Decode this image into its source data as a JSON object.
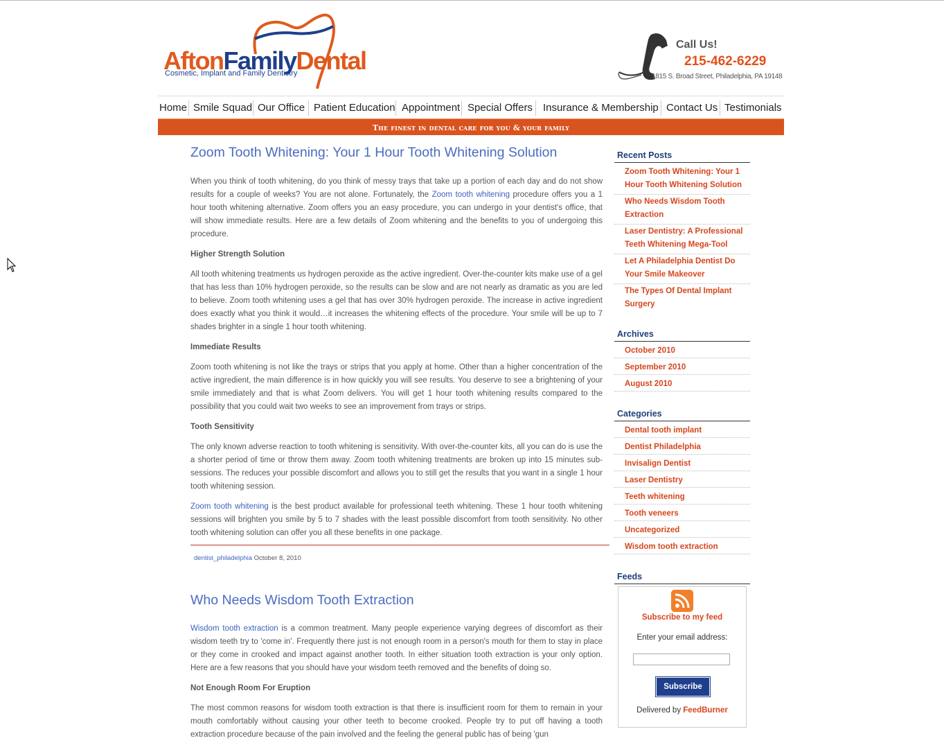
{
  "header": {
    "logo": {
      "word1": "Afton",
      "word2": "Family",
      "word3": "Dental",
      "tagline": "Cosmetic, Implant and Family Dentistry"
    },
    "call_label": "Call Us!",
    "phone": "215-462-6229",
    "address": "1815 S. Broad Street, Philadelphia, PA 19148"
  },
  "nav": {
    "items": [
      "Home",
      "Smile Squad",
      "Our Office",
      "Patient Education",
      "Appointment",
      "Special Offers",
      "Insurance & Membership",
      "Contact Us",
      "Testimonials"
    ]
  },
  "banner": "The finest in dental care for you & your family",
  "posts": [
    {
      "title": "Zoom Tooth Whitening: Your 1 Hour Tooth Whitening Solution",
      "intro_a": "When you think of tooth whitening, do you think of messy trays that take up a portion of each day and do not show results for a couple of weeks? You are not alone. Fortunately, the ",
      "intro_link": "Zoom tooth whitening",
      "intro_b": " procedure offers you a 1 hour tooth whitening alternative. Zoom offers you an easy procedure, you can undergo in your dentist's office, that will show immediate results. Here are a few details of Zoom whitening and the benefits to you of undergoing this procedure.",
      "h1": "Higher Strength Solution",
      "p1": "All tooth whitening treatments us hydrogen peroxide as the active ingredient. Over-the-counter kits make use of a gel that has less than 10% hydrogen peroxide, so the results can be slow and are not nearly as dramatic as you are led to believe. Zoom tooth whitening uses a gel that has over 30% hydrogen peroxide. The increase in active ingredient does exactly what you think it would…it increases the whitening effects of the procedure. Your smile will be up to 7 shades brighter in a single 1 hour tooth whitening.",
      "h2": "Immediate Results",
      "p2": "Zoom tooth whitening is not like the trays or strips that you apply at home. Other than a higher concentration of the active ingredient, the main difference is in how quickly you will see results. You deserve to see a brightening of your smile immediately and that is what Zoom delivers. You will get 1 hour tooth whitening results compared to the possibility that you could wait two weeks to see an improvement from trays or strips.",
      "h3": "Tooth Sensitivity",
      "p3": "The only known adverse reaction to tooth whitening is sensitivity. With over-the-counter kits, all you can do is use the a shorter period of time or throw them away. Zoom tooth whitening treatments are broken up into 15 minutes sub-sessions. The reduces your possible discomfort and allows you to still get the results that you want in a single 1 hour tooth whitening session.",
      "p4_link": "Zoom tooth whitening",
      "p4": " is the best product available for professional teeth whitening. These 1 hour tooth whitening sessions will brighten you smile by 5 to 7 shades with the least possible discomfort from tooth sensitivity. No other tooth whitening solution can offer you all these benefits in one package.",
      "author": "dentist_philadelphia",
      "date": "October 8, 2010"
    },
    {
      "title": "Who Needs Wisdom Tooth Extraction",
      "intro_link": "Wisdom tooth extraction",
      "intro_b": " is a common treatment. Many people experience varying degrees of discomfort as their wisdom teeth try to 'come in'. Frequently there just is not enough room in a person's mouth for them to stay in place or they come in crooked and impact against another tooth. In either situation tooth extraction is your only option. Here are a few reasons that you should have your wisdom teeth removed and the benefits of doing so.",
      "h1": "Not Enough Room For Eruption",
      "p1": "The most common reasons for wisdom tooth extraction is that there is insufficient room for them to remain in your mouth comfortably without causing your other teeth to become crooked. People try to put off having a tooth extraction procedure because of the pain involved and the feeling the general public has of being 'gun"
    }
  ],
  "sidebar": {
    "recent_title": "Recent Posts",
    "recent": [
      "Zoom Tooth Whitening: Your 1 Hour Tooth Whitening Solution",
      "Who Needs Wisdom Tooth Extraction",
      "Laser Dentistry: A Professional Teeth Whitening Mega-Tool",
      "Let A Philadelphia Dentist Do Your Smile Makeover",
      "The Types Of Dental Implant Surgery"
    ],
    "archives_title": "Archives",
    "archives": [
      "October 2010",
      "September 2010",
      "August 2010"
    ],
    "categories_title": "Categories",
    "categories": [
      "Dental tooth implant",
      "Dentist Philadelphia",
      "Invisalign Dentist",
      "Laser Dentistry",
      "Teeth whitening",
      "Tooth veneers",
      "Uncategorized",
      "Wisdom tooth extraction"
    ],
    "feeds_title": "Feeds",
    "feed_subscribe": "Subscribe to my feed",
    "feed_email_label": "Enter your email address:",
    "feed_email_value": "",
    "feed_button": "Subscribe",
    "feed_delivered": "Delivered by ",
    "feed_provider": "FeedBurner"
  },
  "colors": {
    "brand_orange": "#d9531e",
    "brand_blue": "#1e3f8c",
    "link_blue": "#4a6cc0"
  }
}
